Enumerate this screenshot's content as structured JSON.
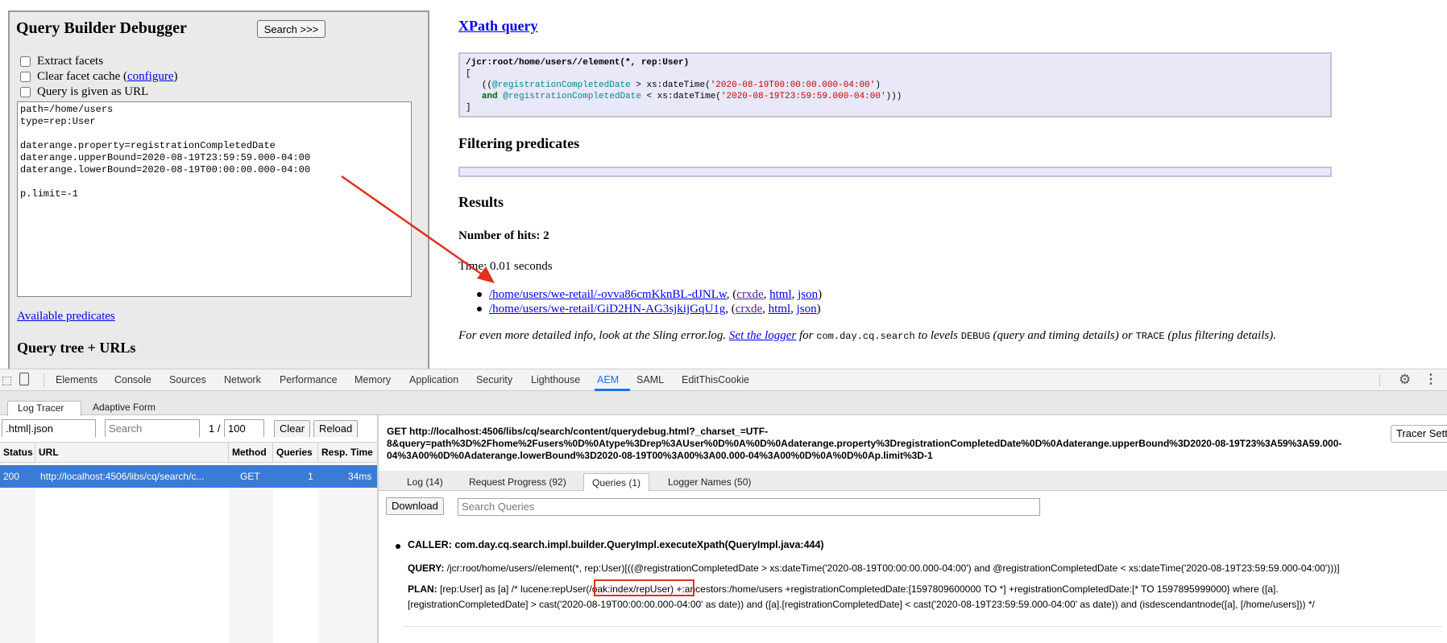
{
  "query_builder": {
    "title": "Query Builder Debugger",
    "search_button": "Search >>>",
    "options": {
      "extract_facets": "Extract facets",
      "clear_cache_prefix": "Clear facet cache (",
      "configure": "configure",
      "clear_cache_suffix": ")",
      "query_as_url": "Query is given as URL"
    },
    "query_text": "path=/home/users\ntype=rep:User\n\ndaterange.property=registrationCompletedDate\ndaterange.upperBound=2020-08-19T23:59:59.000-04:00\ndaterange.lowerBound=2020-08-19T00:00:00.000-04:00\n\np.limit=-1",
    "available_predicates": "Available predicates",
    "query_tree": "Query tree + URLs"
  },
  "xpath": {
    "title": "XPath query",
    "line1": "/jcr:root/home/users//element(*, rep:User)",
    "open_bracket": "[",
    "close_bracket": "]",
    "l2_open": "((",
    "l2_attr": "@registrationCompletedDate",
    "l2_op": " > xs:dateTime(",
    "l2_str": "'2020-08-19T00:00:00.000-04:00'",
    "l2_close": ")",
    "l3_and": "and",
    "l3_attr": "@registrationCompletedDate",
    "l3_op": " < xs:dateTime(",
    "l3_str": "'2020-08-19T23:59:59.000-04:00'",
    "l3_close": ")))"
  },
  "filtering": {
    "title": "Filtering predicates"
  },
  "results": {
    "title": "Results",
    "hits": "Number of hits: 2",
    "time": "Time: 0.01 seconds",
    "items": [
      {
        "path": "/home/users/we-retail/-ovva86cmKknBL-dJNLw",
        "crxde": "crxde",
        "html": "html",
        "json": "json"
      },
      {
        "path": "/home/users/we-retail/GiD2HN-AG3sjkijGqU1g",
        "crxde": "crxde",
        "html": "html",
        "json": "json"
      }
    ],
    "info_prefix": "For even more detailed info, look at the Sling error.log.",
    "set_logger": "Set the logger",
    "info_for": " for ",
    "info_pkg": "com.day.cq.search",
    "info_levels": " to levels ",
    "info_debug": "DEBUG",
    "info_mid": " (query and timing details) or ",
    "info_trace": "TRACE",
    "info_end": " (plus filtering details)."
  },
  "devtools": {
    "tabs": [
      "Elements",
      "Console",
      "Sources",
      "Network",
      "Performance",
      "Memory",
      "Application",
      "Security",
      "Lighthouse",
      "AEM",
      "SAML",
      "EditThisCookie"
    ],
    "active_tab": "AEM",
    "subtabs": {
      "log_tracer": "Log Tracer",
      "adaptive_form": "Adaptive Form"
    },
    "filter": {
      "url_value": ".html|.json",
      "search_placeholder": "Search",
      "page": "1 /",
      "page_size": "100",
      "clear": "Clear",
      "reload": "Reload"
    },
    "table": {
      "headers": [
        "Status",
        "URL",
        "Method",
        "Queries",
        "Resp. Time"
      ],
      "row": {
        "status": "200",
        "url": "http://localhost:4506/libs/cq/search/c...",
        "method": "GET",
        "queries": "1",
        "time": "34ms"
      }
    },
    "request": {
      "get_line": "GET http://localhost:4506/libs/cq/search/content/querydebug.html?_charset_=UTF-8&query=path%3D%2Fhome%2Fusers%0D%0Atype%3Drep%3AUser%0D%0A%0D%0Adaterange.property%3DregistrationCompletedDate%0D%0Adaterange.upperBound%3D2020-08-19T23%3A59%3A59.000-04%3A00%0D%0Adaterange.lowerBound%3D2020-08-19T00%3A00%3A00.000-04%3A00%0D%0A%0D%0Ap.limit%3D-1",
      "tracer_settings": "Tracer Sett",
      "tabs": [
        "Log (14)",
        "Request Progress (92)",
        "Queries (1)",
        "Logger Names (50)"
      ],
      "download": "Download",
      "search_queries_placeholder": "Search Queries",
      "caller": "CALLER: com.day.cq.search.impl.builder.QueryImpl.executeXpath(QueryImpl.java:444)",
      "query_label": "QUERY:",
      "query_value": " /jcr:root/home/users//element(*, rep:User)[((@registrationCompletedDate > xs:dateTime('2020-08-19T00:00:00.000-04:00') and @registrationCompletedDate < xs:dateTime('2020-08-19T23:59:59.000-04:00')))]",
      "plan_label": "PLAN:",
      "plan_line1": " [rep:User] as [a] /* lucene:repUser(/oak:index/repUser) +:ancestors:/home/users +registrationCompletedDate:[1597809600000 TO *] +registrationCompletedDate:[* TO 1597895999000} where ([a].",
      "plan_line2": "[registrationCompletedDate] > cast('2020-08-19T00:00:00.000-04:00' as date)) and ([a].[registrationCompletedDate] < cast('2020-08-19T23:59:59.000-04:00' as date)) and (isdescendantnode([a], [/home/users])) */"
    }
  },
  "colors": {
    "annotation": "#e0301e",
    "selection": "#3a7bd5",
    "link": "#0000ee"
  }
}
